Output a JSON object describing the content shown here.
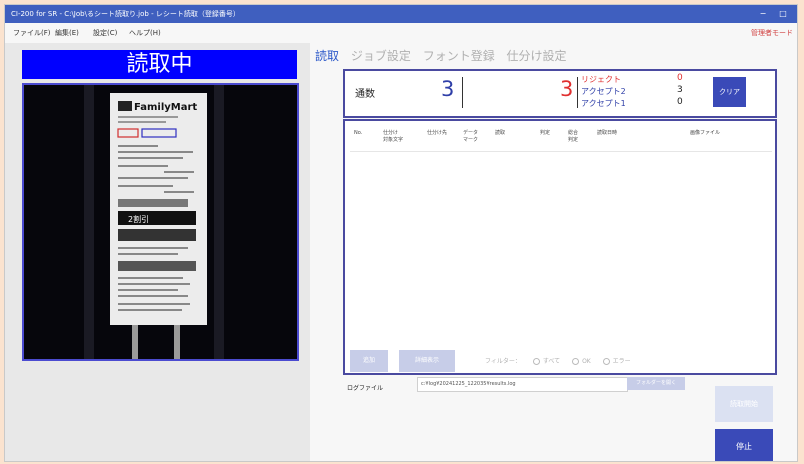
{
  "window": {
    "title": "CI-200 for SR - C:\\Job\\るシート読取り.job - レシート読取（登録番号）",
    "minimize": "−",
    "maximize": "□"
  },
  "menu": {
    "items": [
      "ファイル(F)",
      "編集(E)",
      "設定(C)",
      "ヘルプ(H)"
    ],
    "admin_mode": "管理者モード"
  },
  "status_banner": "読取中",
  "camera": {
    "receipt_logo": "FamilyMart",
    "receipt_discount": "2割引"
  },
  "tabs": [
    {
      "label": "読取",
      "active": true
    },
    {
      "label": "ジョブ設定",
      "active": false
    },
    {
      "label": "フォント登録",
      "active": false
    },
    {
      "label": "仕分け設定",
      "active": false
    }
  ],
  "counters": {
    "count_label": "通数",
    "total": "3",
    "ng_count": "3",
    "reject_label": "リジェクト",
    "reject_value": "0",
    "accept2_label": "アクセプト2",
    "accept2_value": "3",
    "accept1_label": "アクセプト1",
    "accept1_value": "0",
    "clear_label": "クリア"
  },
  "table": {
    "headers": [
      "No.",
      "仕分け\n対象文字",
      "仕分け先",
      "データ\nマーク",
      "読取",
      "判定",
      "総合\n判定",
      "読取日時",
      "画像ファイル"
    ]
  },
  "actions": {
    "add_label": "追加",
    "detail_label": "詳細表示",
    "filter_label": "フィルター：",
    "filter_options": [
      "すべて",
      "OK",
      "エラー"
    ]
  },
  "log": {
    "label": "ログファイル",
    "path": "c:¥log¥20241225_122035¥results.log",
    "open_folder": "フォルダーを開く"
  },
  "buttons": {
    "start": "読取開始",
    "stop": "停止"
  },
  "colors": {
    "accent": "#3a4ab8",
    "banner": "#0000ff",
    "ng_red": "#e03030",
    "count_blue": "#2f3fa8"
  }
}
